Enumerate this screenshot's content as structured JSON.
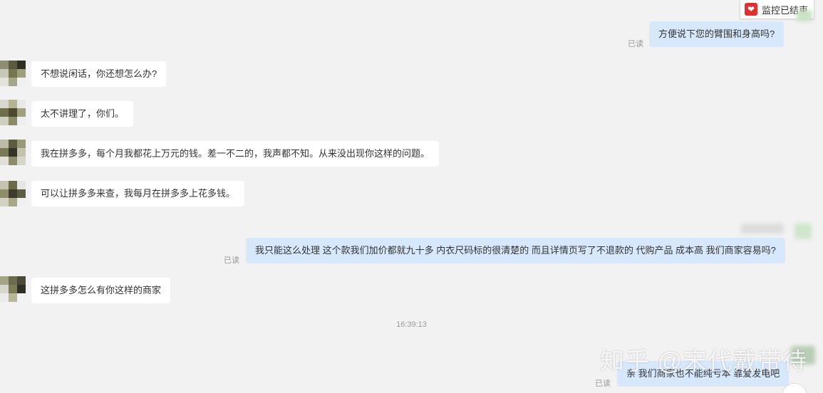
{
  "monitor": {
    "label": "监控已结束",
    "icon": "heart-logo-icon",
    "icon_color": "#e02f2f"
  },
  "read_label": "已读",
  "messages": [
    {
      "direction": "out",
      "text": "方便说下您的臂围和身高吗?",
      "read": "已读"
    },
    {
      "direction": "in",
      "text": "不想说闲话，你还想怎么办?"
    },
    {
      "direction": "in",
      "text": "太不讲理了，你们。"
    },
    {
      "direction": "in",
      "text": "我在拼多多，每个月我都花上万元的钱。差一不二的，我声都不知。从来没出现你这样的问题。"
    },
    {
      "direction": "in",
      "text": "可以让拼多多来查，我每月在拼多多上花多钱。"
    },
    {
      "direction": "out",
      "text": "我只能这么处理 这个款我们加价都就九十多 内衣尺码标的很清楚的 而且详情页写了不退款的 代购产品 成本高 我们商家容易吗?",
      "read": "已读"
    },
    {
      "direction": "in",
      "text": "这拼多多怎么有你这样的商家"
    },
    {
      "direction": "out",
      "text": "亲 我们商家也不能纯亏本 靠爱发电吧",
      "read": "已读"
    }
  ],
  "timestamp": "16:39:13",
  "watermark": "知乎 @宋代戴带待",
  "colors": {
    "background": "#f2f2f2",
    "incoming_bubble": "#ffffff",
    "outgoing_bubble": "#d7e8fd",
    "read_text": "#9a9a9a"
  }
}
